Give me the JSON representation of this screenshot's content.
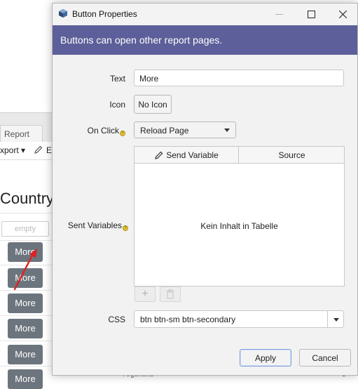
{
  "background": {
    "tab_label": "Report",
    "export_label": "xport",
    "edit_label": "E",
    "heading": "Country",
    "filter_placeholder": "empty",
    "row_button_label": "More",
    "footer_fragment_1": "Argentina",
    "footer_fragment_2": "3"
  },
  "dialog": {
    "title": "Button Properties",
    "header_text": "Buttons can open other report pages.",
    "fields": {
      "text_label": "Text",
      "text_value": "More",
      "icon_label": "Icon",
      "icon_button": "No Icon",
      "onclick_label": "On Click",
      "onclick_value": "Reload Page",
      "sent_variables_label": "Sent Variables",
      "css_label": "CSS",
      "css_value": "btn btn-sm btn-secondary"
    },
    "table": {
      "columns": [
        "Send Variable",
        "Source"
      ],
      "empty_message": "Kein Inhalt in Tabelle",
      "add_button": "+"
    },
    "buttons": {
      "apply": "Apply",
      "cancel": "Cancel"
    }
  },
  "colors": {
    "header_band": "#5c5f99",
    "row_button": "#6c757d",
    "arrow": "#e02020",
    "help_icon": "#e3c23b"
  }
}
